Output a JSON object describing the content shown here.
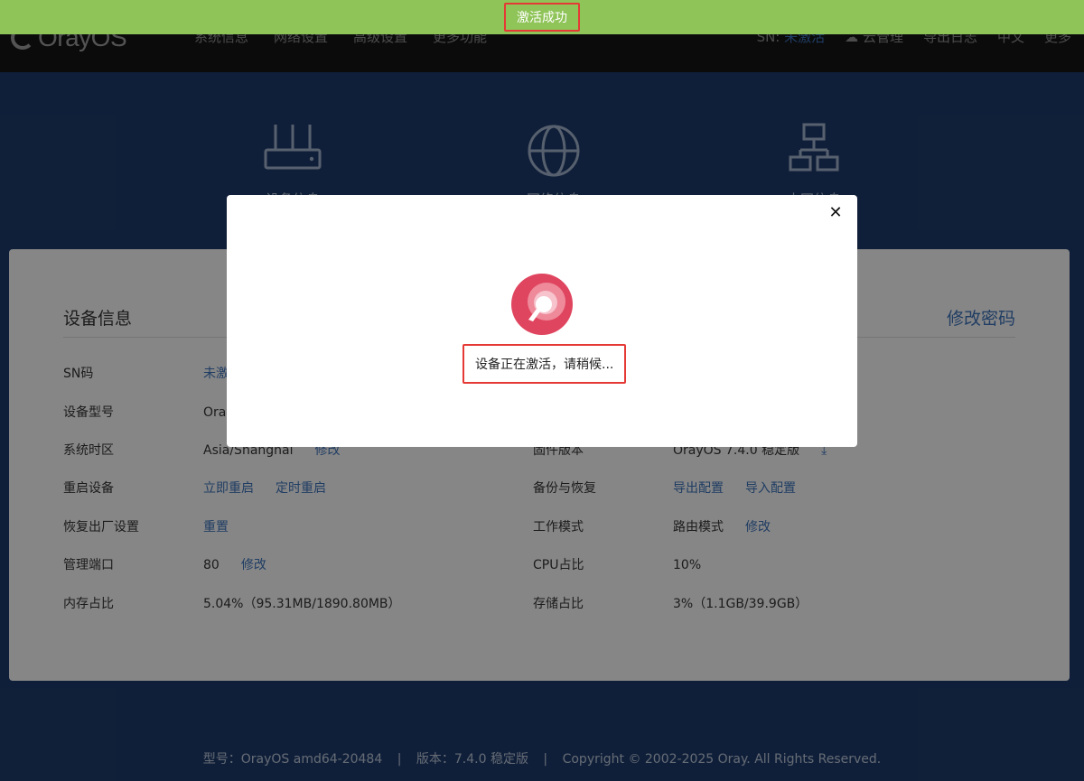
{
  "header": {
    "brand": "OrayOS",
    "menu": [
      "系统信息",
      "网络设置",
      "高级设置",
      "更多功能"
    ],
    "sn_label": "SN:",
    "sn_value": "未激活",
    "cloud_manage": "云管理",
    "export_log": "导出日志",
    "language": "中文",
    "more": "更多"
  },
  "hero": {
    "cards": [
      {
        "label": "设备信息",
        "icon": "router-icon"
      },
      {
        "label": "网络信息",
        "icon": "globe-icon"
      },
      {
        "label": "内网信息",
        "icon": "network-icon"
      }
    ]
  },
  "device_info": {
    "title": "设备信息",
    "change_password": "修改密码",
    "left_rows": [
      {
        "label": "SN码",
        "value": "未激活"
      },
      {
        "label": "设备型号",
        "value": "OrayOS"
      },
      {
        "label": "系统时区",
        "value": "Asia/Shanghai",
        "action": "修改"
      },
      {
        "label": "重启设备",
        "action": "立即重启",
        "action2": "定时重启"
      },
      {
        "label": "恢复出厂设置",
        "action": "重置"
      },
      {
        "label": "管理端口",
        "value": "80",
        "action": "修改"
      },
      {
        "label": "内存占比",
        "value": "5.04%（95.31MB/1890.80MB）"
      }
    ],
    "right_rows": [
      {
        "label": "固件版本",
        "value": "OrayOS 7.4.0 稳定版"
      },
      {
        "label": "备份与恢复",
        "action": "导出配置",
        "action2": "导入配置"
      },
      {
        "label": "工作模式",
        "value": "路由模式",
        "action": "修改"
      },
      {
        "label": "CPU占比",
        "value": "10%"
      },
      {
        "label": "存储占比",
        "value": "3%（1.1GB/39.9GB）"
      }
    ]
  },
  "footer": {
    "model": "型号：OrayOS amd64-20484",
    "version": "版本：7.4.0 稳定版",
    "copyright": "Copyright © 2002-2025 Oray. All Rights Reserved."
  },
  "toast": {
    "message": "激活成功",
    "color": "#8fc458"
  },
  "modal": {
    "message": "设备正在激活，请稍候...",
    "close_symbol": "✕"
  },
  "colors": {
    "accent": "#3b6fb5",
    "highlight_border": "#e53935",
    "spinner": "#e0455f"
  }
}
